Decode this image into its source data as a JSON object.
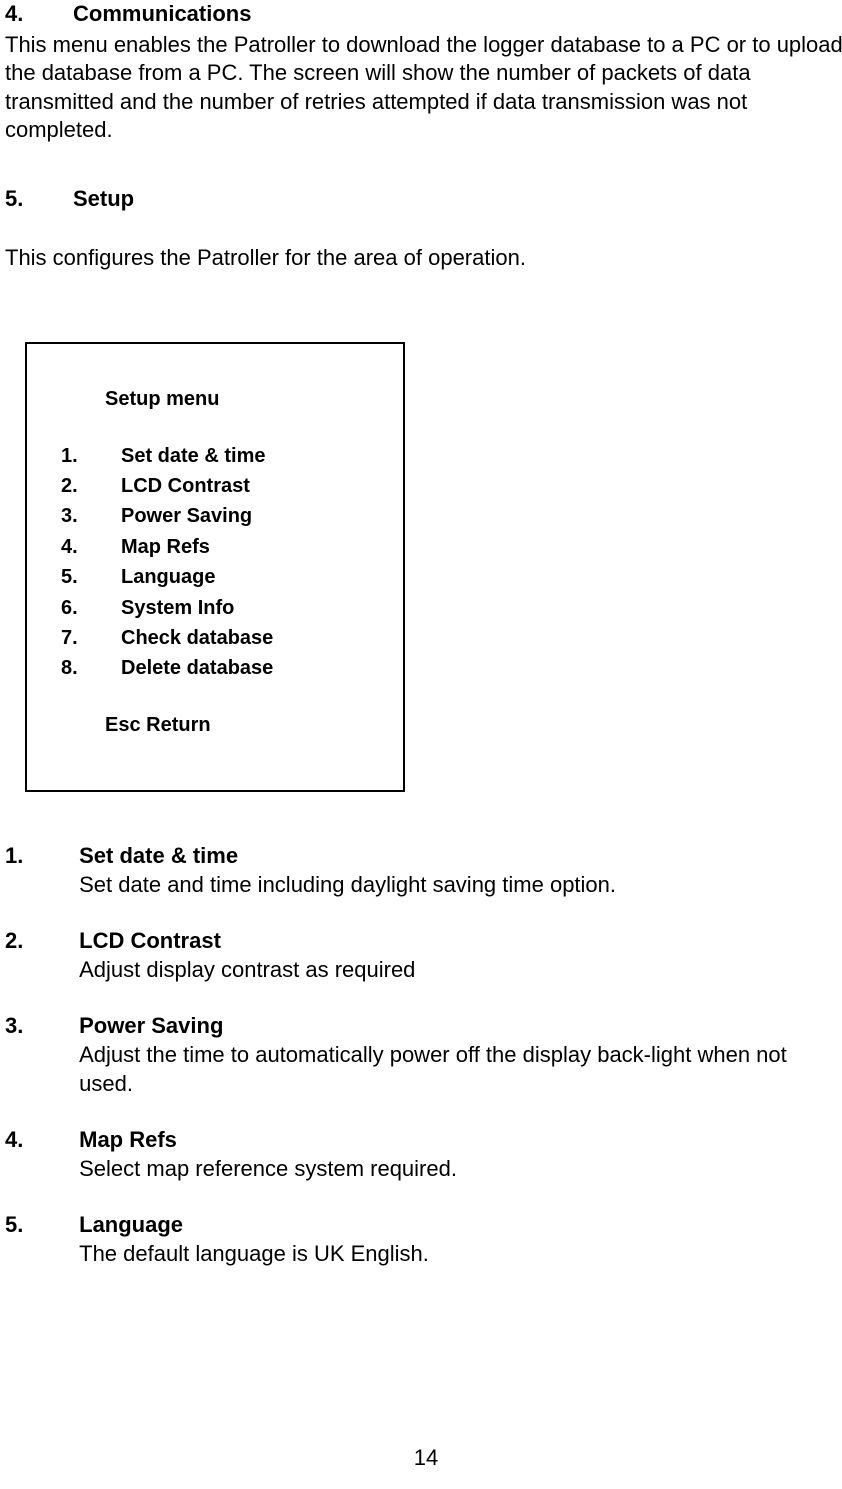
{
  "section4": {
    "num": "4.",
    "title": "Communications",
    "body": "This menu enables the Patroller to download the logger database to a PC or to upload the database from a PC.  The screen will show the number of packets of data transmitted and the number of retries attempted if data transmission was not completed."
  },
  "section5": {
    "num": "5.",
    "title": "Setup",
    "body": "This configures the Patroller for the area of operation."
  },
  "menu": {
    "title": "Setup menu",
    "items": [
      {
        "num": "1.",
        "label": "Set date & time"
      },
      {
        "num": "2.",
        "label": "LCD Contrast"
      },
      {
        "num": "3.",
        "label": "Power Saving"
      },
      {
        "num": "4.",
        "label": "Map Refs"
      },
      {
        "num": "5.",
        "label": "Language"
      },
      {
        "num": "6.",
        "label": "System Info"
      },
      {
        "num": "7.",
        "label": "Check database"
      },
      {
        "num": "8.",
        "label": "Delete database"
      }
    ],
    "footer": "Esc  Return"
  },
  "defs": [
    {
      "num": "1.",
      "title": "Set date & time",
      "body": "Set date and time including daylight saving time option."
    },
    {
      "num": "2.",
      "title": "LCD Contrast",
      "body": "Adjust display contrast as required"
    },
    {
      "num": "3.",
      "title": "Power Saving",
      "body": "Adjust the time to automatically power off the display back-light when not used."
    },
    {
      "num": "4.",
      "title": "Map Refs",
      "body": "Select map reference system required."
    },
    {
      "num": "5.",
      "title": "Language",
      "body": "The default language is UK English."
    }
  ],
  "pageNumber": "14"
}
